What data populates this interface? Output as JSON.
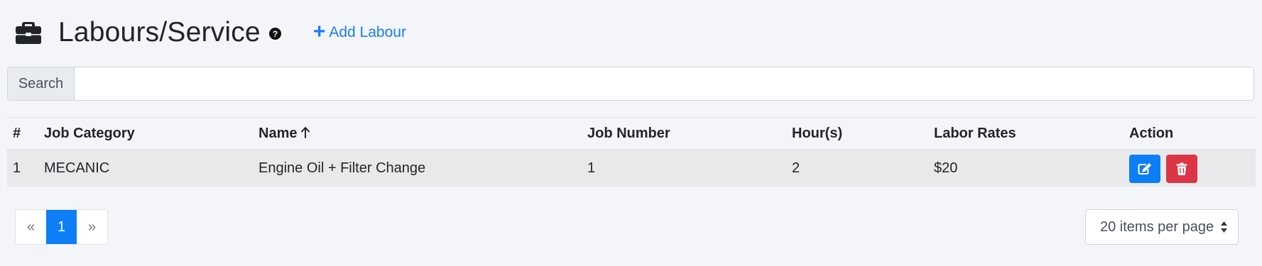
{
  "header": {
    "title": "Labours/Service",
    "add_label": "Add Labour",
    "add_icon": "+"
  },
  "search": {
    "label": "Search",
    "value": "",
    "placeholder": ""
  },
  "table": {
    "columns": [
      "#",
      "Job Category",
      "Name",
      "Job Number",
      "Hour(s)",
      "Labor Rates",
      "Action"
    ],
    "sorted_column": "Name",
    "sort_direction": "ascending",
    "rows": [
      {
        "index": "1",
        "job_category": "MECANIC",
        "name": "Engine Oil + Filter Change",
        "job_number": "1",
        "hours": "2",
        "labor_rates": "$20"
      }
    ]
  },
  "pagination": {
    "prev": "«",
    "pages": [
      "1"
    ],
    "current": "1",
    "next": "»"
  },
  "per_page": {
    "label": "20 items per page"
  },
  "colors": {
    "accent": "#0d7ef5",
    "link": "#1a7cf0",
    "danger": "#dc3545",
    "background": "#f4f5f8"
  }
}
